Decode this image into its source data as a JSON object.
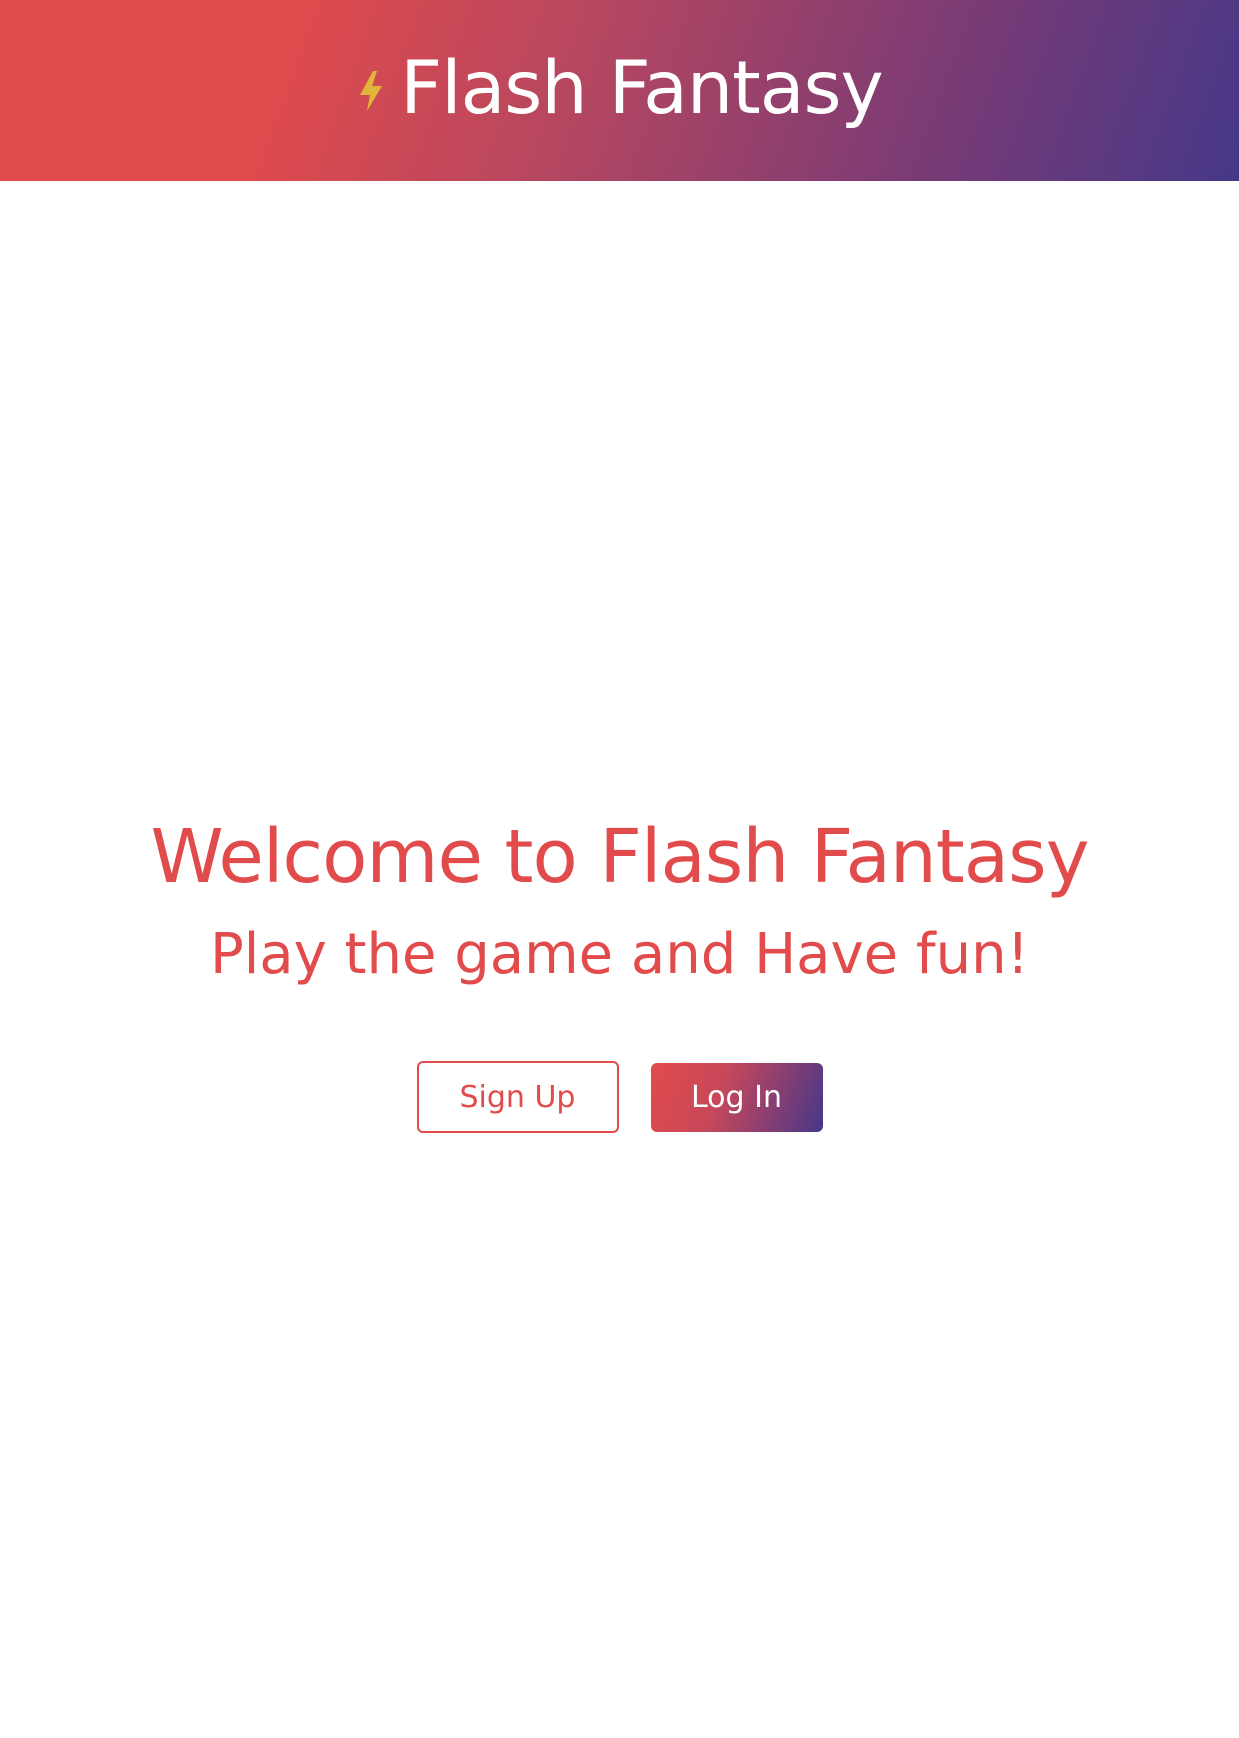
{
  "header": {
    "brand_icon": "lightning-bolt-icon",
    "brand_title": "Flash Fantasy",
    "gradient_start": "#e24b4b",
    "gradient_end": "#453888",
    "icon_color": "#e0b63a"
  },
  "hero": {
    "title": "Welcome to Flash Fantasy",
    "subtitle": "Play the game and Have fun!",
    "text_color": "#e24b4b"
  },
  "actions": {
    "signup_label": "Sign Up",
    "login_label": "Log In"
  }
}
